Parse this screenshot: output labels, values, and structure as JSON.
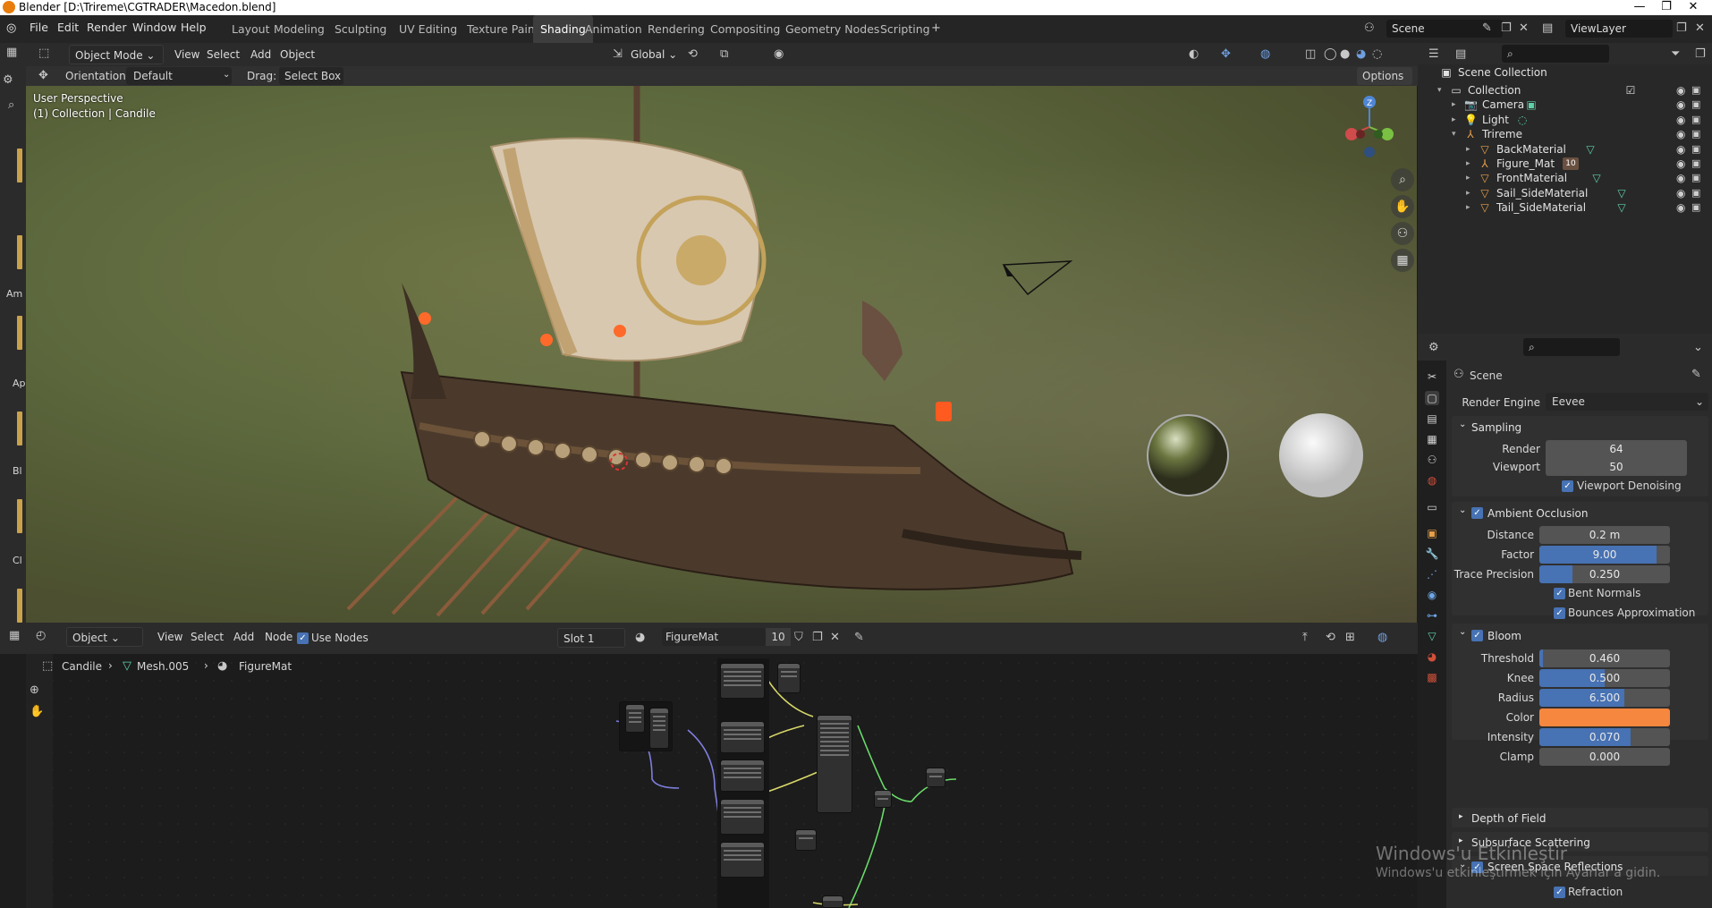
{
  "title_bar": {
    "title": "Blender [D:\\Trireme\\CGTRADER\\Macedon.blend]",
    "minimize": "—",
    "restore": "❐",
    "close": "✕"
  },
  "menu": {
    "file": "File",
    "edit": "Edit",
    "render": "Render",
    "window": "Window",
    "help": "Help"
  },
  "workspaces": [
    "Layout",
    "Modeling",
    "Sculpting",
    "UV Editing",
    "Texture Paint",
    "Shading",
    "Animation",
    "Rendering",
    "Compositing",
    "Geometry Nodes",
    "Scripting"
  ],
  "active_workspace": "Shading",
  "scene_field": "Scene",
  "viewlayer_field": "ViewLayer",
  "viewport_header": {
    "mode": "Object Mode",
    "view": "View",
    "select": "Select",
    "add": "Add",
    "object": "Object",
    "transform": "Global"
  },
  "tool_header": {
    "orientation_label": "Orientation:",
    "orientation_value": "Default",
    "drag_label": "Drag:",
    "drag_value": "Select Box",
    "options": "Options"
  },
  "viewport_info": {
    "perspective": "User Perspective",
    "collection": "(1) Collection | Candile"
  },
  "gizmo": {
    "z": "Z"
  },
  "left_strip_letters": [
    "Am",
    "Ap",
    "Bl",
    "Cl"
  ],
  "node_header": {
    "editor_type": "Object",
    "view": "View",
    "select": "Select",
    "add": "Add",
    "node": "Node",
    "use_nodes": "Use Nodes",
    "slot": "Slot 1",
    "material": "FigureMat",
    "users": "10"
  },
  "breadcrumb": {
    "object": "Candile",
    "mesh": "Mesh.005",
    "material": "FigureMat"
  },
  "outliner": {
    "root": "Scene Collection",
    "rows": [
      {
        "name": "Collection",
        "icon": "collection-icon"
      },
      {
        "name": "Camera",
        "icon": "camera-icon"
      },
      {
        "name": "Light",
        "icon": "light-icon"
      },
      {
        "name": "Trireme",
        "icon": "armature-icon"
      },
      {
        "name": "BackMaterial",
        "icon": "mesh-icon"
      },
      {
        "name": "Figure_Mat",
        "icon": "armature-icon",
        "badge": "10"
      },
      {
        "name": "FrontMaterial",
        "icon": "mesh-icon"
      },
      {
        "name": "Sail_SideMaterial",
        "icon": "mesh-icon"
      },
      {
        "name": "Tail_SideMaterial",
        "icon": "mesh-icon"
      }
    ]
  },
  "properties": {
    "context": "Scene",
    "render_engine_label": "Render Engine",
    "render_engine": "Eevee",
    "sampling": {
      "title": "Sampling",
      "render_label": "Render",
      "render": "64",
      "viewport_label": "Viewport",
      "viewport": "50",
      "denoise": "Viewport Denoising"
    },
    "ao": {
      "title": "Ambient Occlusion",
      "distance_label": "Distance",
      "distance": "0.2 m",
      "factor_label": "Factor",
      "factor": "9.00",
      "factor_fill": 0.9,
      "trace_label": "Trace Precision",
      "trace": "0.250",
      "trace_fill": 0.25,
      "bent": "Bent Normals",
      "bounces": "Bounces Approximation"
    },
    "bloom": {
      "title": "Bloom",
      "threshold_label": "Threshold",
      "threshold": "0.460",
      "threshold_fill": 0.02,
      "knee_label": "Knee",
      "knee": "0.500",
      "knee_fill": 0.5,
      "radius_label": "Radius",
      "radius": "6.500",
      "radius_fill": 0.65,
      "color_label": "Color",
      "color": "#f5873f",
      "intensity_label": "Intensity",
      "intensity": "0.070",
      "intensity_fill": 0.7,
      "clamp_label": "Clamp",
      "clamp": "0.000"
    },
    "dof": "Depth of Field",
    "sss": "Subsurface Scattering",
    "ssr": "Screen Space Reflections",
    "refraction": "Refraction"
  },
  "watermark": {
    "line1": "Windows'u Etkinleştir",
    "line2": "Windows'u etkinleştirmek için Ayarlar'a gidin."
  },
  "colors": {
    "accent": "#4772b3",
    "active_tab": "#3d3d3d",
    "mesh_icon": "#e8a04a",
    "data_icon": "#3fbf8f"
  }
}
